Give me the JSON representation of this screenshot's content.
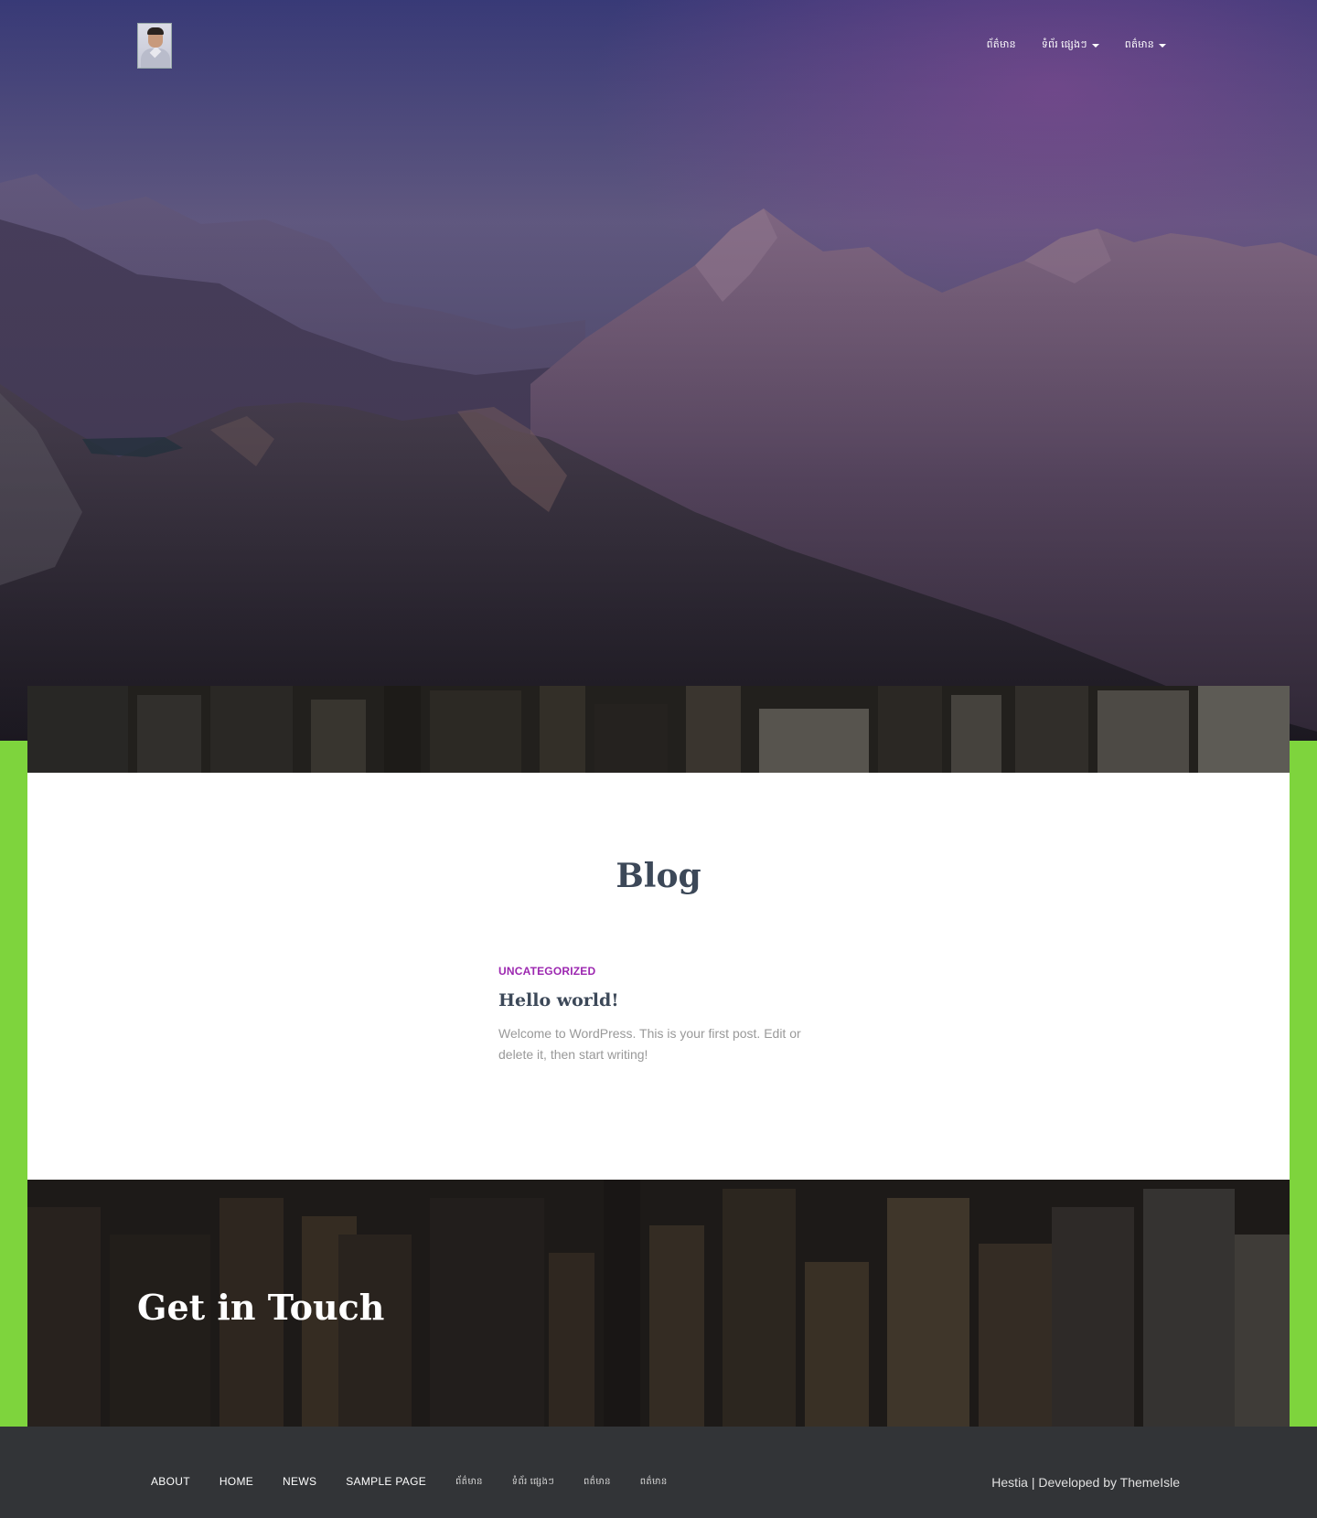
{
  "header": {
    "logo_alt": "Site logo",
    "nav": [
      {
        "label": "ព័ត៌មាន",
        "has_dropdown": false
      },
      {
        "label": "ទំព័រ ផ្សេងៗ",
        "has_dropdown": true
      },
      {
        "label": "ពត៌មាន",
        "has_dropdown": true
      }
    ]
  },
  "blog": {
    "title": "Blog",
    "post": {
      "category": "UNCATEGORIZED",
      "title": "Hello world!",
      "excerpt": "Welcome to WordPress. This is your first post. Edit or delete it, then start writing!"
    }
  },
  "contact": {
    "title": "Get in Touch"
  },
  "footer": {
    "menu": [
      {
        "label": "ABOUT"
      },
      {
        "label": "HOME"
      },
      {
        "label": "NEWS"
      },
      {
        "label": "SAMPLE PAGE"
      },
      {
        "label": "ព័ត៌មាន"
      },
      {
        "label": "ទំព័រ ផ្សេងៗ"
      },
      {
        "label": "ពត៌មាន"
      },
      {
        "label": "ពត៌មាន"
      }
    ],
    "credits_prefix": "Hestia | Developed by ",
    "credits_link": "ThemeIsle"
  },
  "colors": {
    "accent": "#9c27b0",
    "page_background": "#7ed43d",
    "heading": "#3c4858",
    "footer_background": "#323437"
  }
}
